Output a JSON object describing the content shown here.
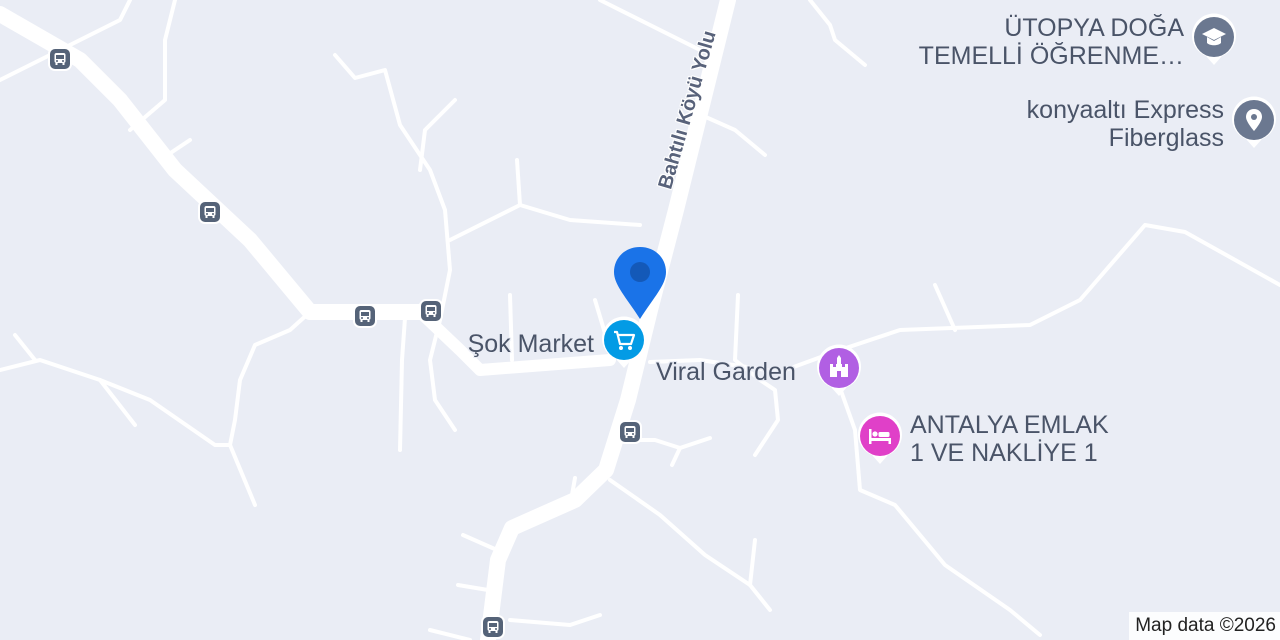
{
  "map": {
    "road_name": "Bahtılı Köyü Yolu",
    "attribution": "Map data ©2026",
    "colors": {
      "background": "#eaedf5",
      "road": "#ffffff",
      "label_text": "#4a5468",
      "location_pin": "#1a73e8",
      "shopping": "#039be5",
      "amusement": "#b15fe3",
      "lodging": "#e040c8",
      "education": "#6b7890",
      "generic": "#6b7890",
      "transit": "#556378"
    },
    "places": [
      {
        "id": "sok-market",
        "lines": [
          "Şok Market"
        ],
        "icon": "shopping-cart-icon"
      },
      {
        "id": "viral-garden",
        "lines": [
          "Viral Garden"
        ],
        "icon": "castle-icon"
      },
      {
        "id": "antalya-emlak",
        "lines": [
          "ANTALYA EMLAK",
          "1 VE NAKLİYE 1"
        ],
        "icon": "bed-icon"
      },
      {
        "id": "utopya",
        "lines": [
          "ÜTOPYA DOĞA",
          "TEMELLİ ÖĞRENME…"
        ],
        "icon": "graduation-cap-icon"
      },
      {
        "id": "konyaalti",
        "lines": [
          "konyaaltı Express",
          "Fiberglass"
        ],
        "icon": "place-icon"
      }
    ],
    "bus_stops": 6
  }
}
